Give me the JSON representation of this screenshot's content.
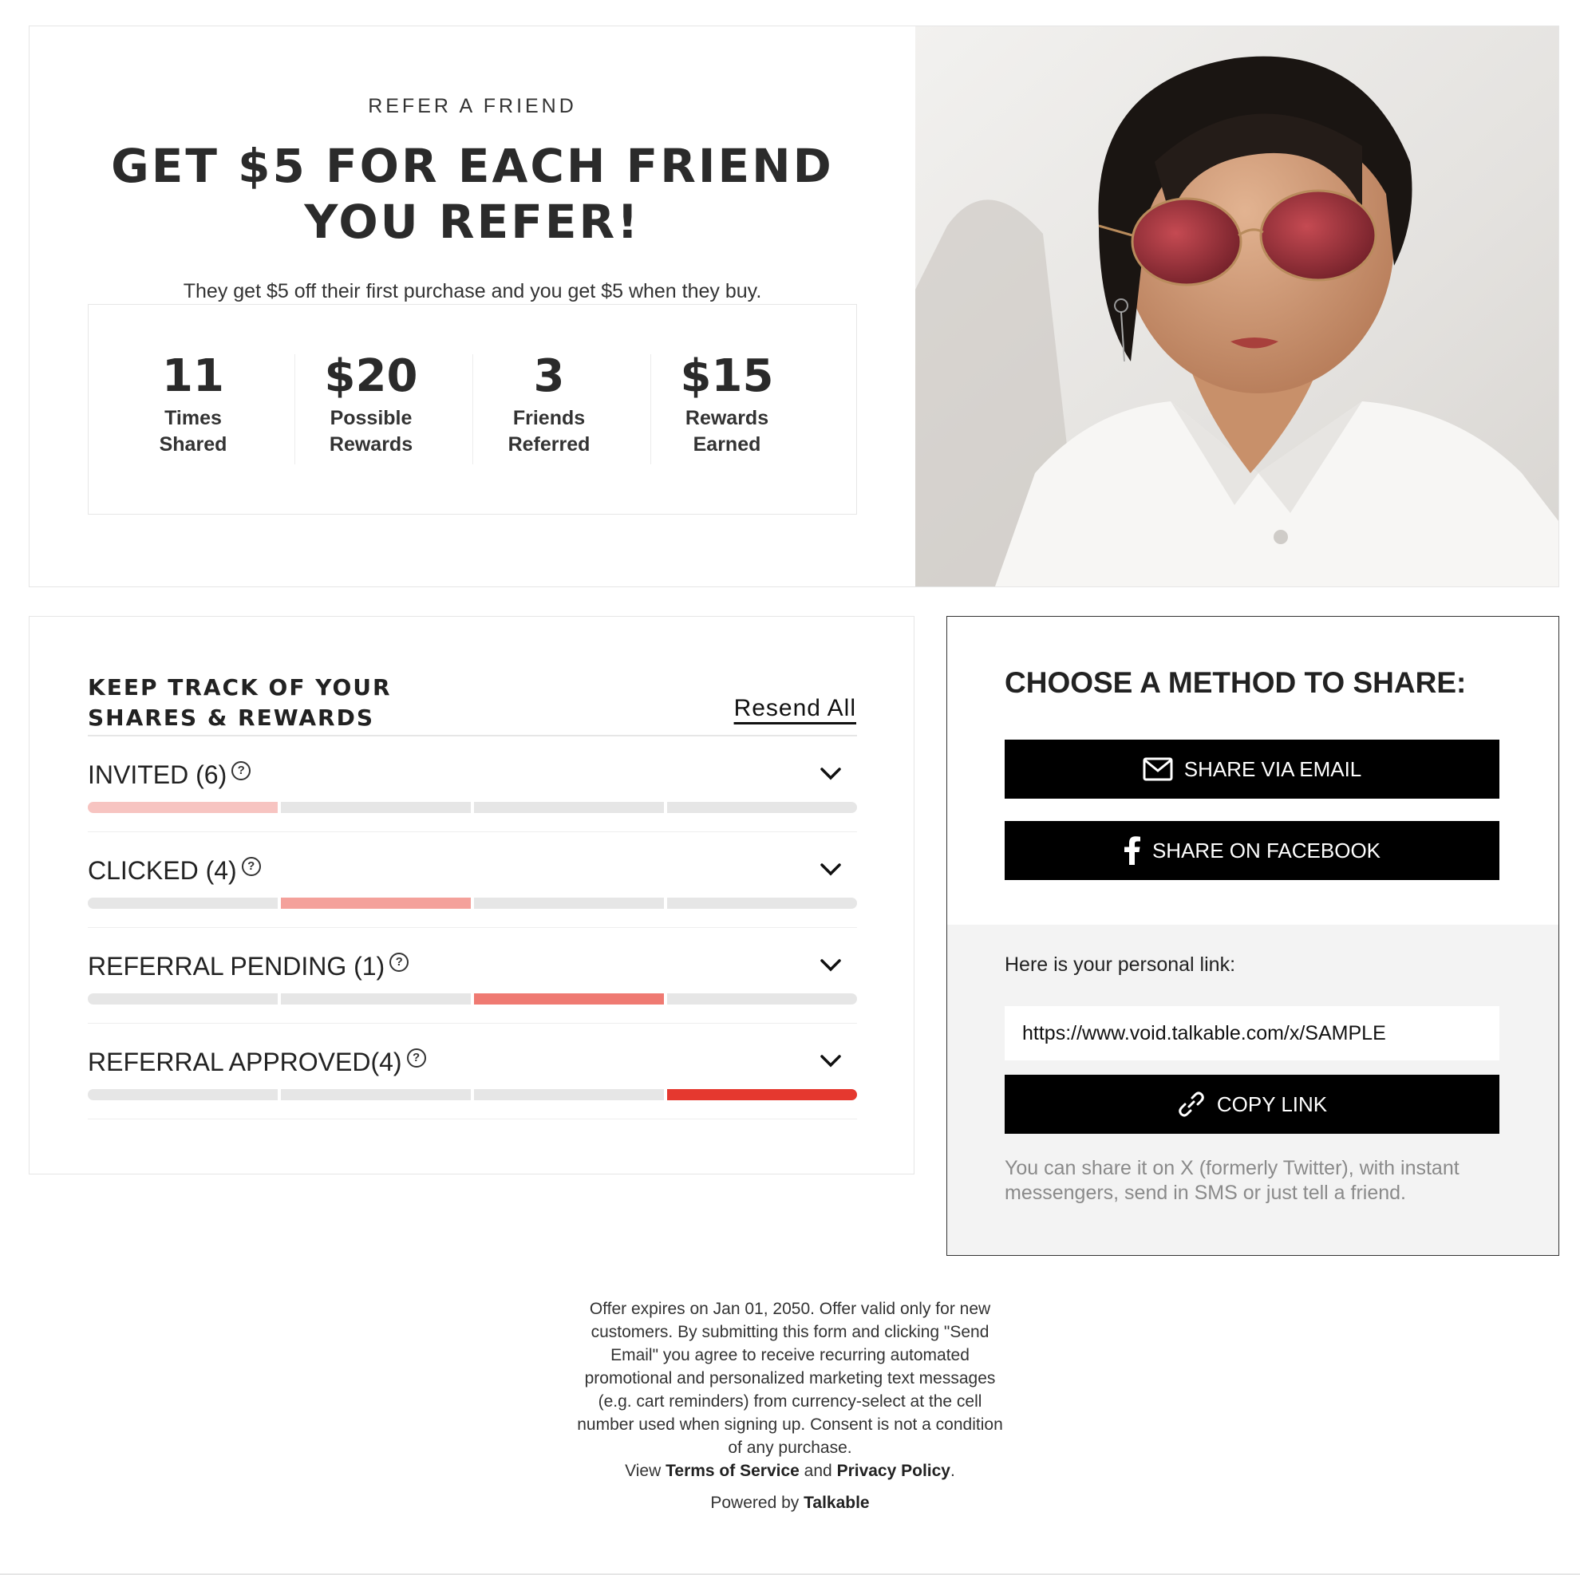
{
  "hero": {
    "eyebrow": "REFER A FRIEND",
    "headline_line1": "GET $5 FOR EACH FRIEND",
    "headline_line2": "YOU REFER!",
    "subline": "They get $5 off their first purchase and you get $5 when they buy.",
    "stats": [
      {
        "value": "11",
        "label_line1": "Times",
        "label_line2": "Shared"
      },
      {
        "value": "$20",
        "label_line1": "Possible",
        "label_line2": "Rewards"
      },
      {
        "value": "3",
        "label_line1": "Friends",
        "label_line2": "Referred"
      },
      {
        "value": "$15",
        "label_line1": "Rewards",
        "label_line2": "Earned"
      }
    ]
  },
  "track": {
    "title_line1": "KEEP TRACK OF YOUR",
    "title_line2": "SHARES & REWARDS",
    "resend_label": "Resend All",
    "rows": [
      {
        "label": "INVITED (6)",
        "active_segment": 1,
        "color": "#f7c4c1"
      },
      {
        "label": "CLICKED (4)",
        "active_segment": 2,
        "color": "#f4a19b"
      },
      {
        "label": "REFERRAL PENDING (1)",
        "active_segment": 3,
        "color": "#ef7a72"
      },
      {
        "label": "REFERRAL APPROVED(4)",
        "active_segment": 4,
        "color": "#e5382f"
      }
    ],
    "segment_count": 4,
    "help_icon_glyph": "?"
  },
  "share": {
    "title": "CHOOSE A METHOD TO SHARE:",
    "email_button": "SHARE VIA EMAIL",
    "facebook_button": "SHARE ON FACEBOOK",
    "link_label": "Here is your personal link:",
    "link_value": "https://www.void.talkable.com/x/SAMPLE",
    "copy_button": "COPY LINK",
    "note": "You can share it on X (formerly Twitter), with instant messengers, send in SMS or just tell a friend."
  },
  "footer": {
    "legal": "Offer expires on Jan 01, 2050. Offer valid only for new customers. By submitting this form and clicking \"Send Email\" you agree to receive recurring automated promotional and personalized marketing text messages (e.g. cart reminders) from currency-select at the cell number used when signing up. Consent is not a condition of any purchase.",
    "terms_prefix": "View",
    "terms_link": "Terms of Service",
    "terms_and": "and",
    "privacy_link": "Privacy Policy",
    "terms_suffix": ".",
    "powered_prefix": "Powered by",
    "powered_brand": "Talkable"
  },
  "colors": {
    "button_bg": "#000000",
    "track_inactive": "#e6e6e6",
    "share_panel_bg": "#f3f3f3"
  },
  "icons": {
    "email": "envelope-icon",
    "facebook": "facebook-icon",
    "copy": "link-icon",
    "chevron": "chevron-down-icon",
    "help": "question-circle-icon"
  }
}
